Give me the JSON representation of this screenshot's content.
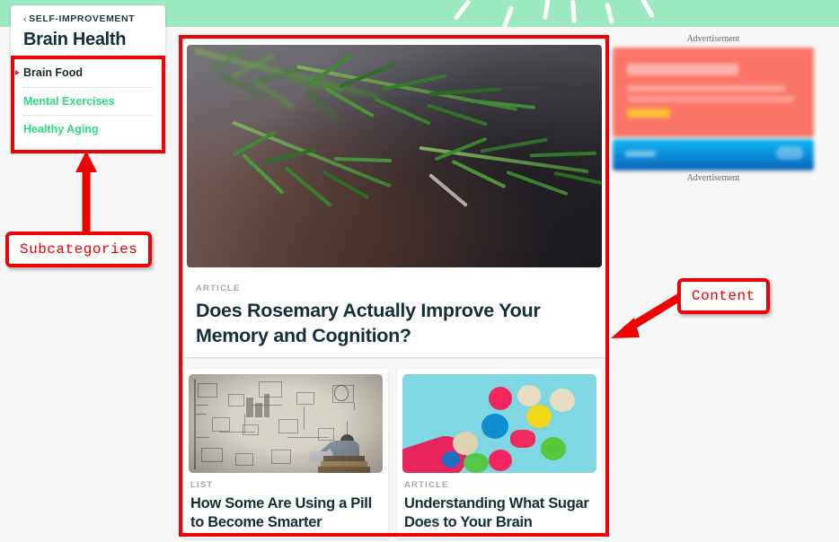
{
  "theme": {
    "band_green": "#9CE8C1",
    "link_green": "#2ddb7e",
    "heading_dark": "#123036",
    "annotation_red": "#f00000",
    "page_bg": "#f7f7f7"
  },
  "sidebar": {
    "breadcrumb_chevron": "chevron-left-icon",
    "breadcrumb": "SELF-IMPROVEMENT",
    "title": "Brain Health",
    "items": [
      {
        "label": "Brain Food",
        "active": true
      },
      {
        "label": "Mental Exercises",
        "active": false
      },
      {
        "label": "Healthy Aging",
        "active": false
      }
    ]
  },
  "main": {
    "featured": {
      "kicker": "ARTICLE",
      "headline": "Does Rosemary Actually Improve Your Memory and Cognition?",
      "image_alt": "rosemary-sprigs-photo"
    },
    "cards": [
      {
        "kicker": "LIST",
        "headline": "How Some Are Using a Pill to Become Smarter",
        "image_alt": "man-with-laptop-sketch-wall-photo"
      },
      {
        "kicker": "ARTICLE",
        "headline": "Understanding What Sugar Does to Your Brain",
        "image_alt": "colorful-macarons-photo"
      }
    ]
  },
  "ads": {
    "top_label": "Advertisement",
    "bottom_label": "Advertisement"
  },
  "annotations": [
    {
      "label": "Subcategories",
      "target": "sidebar-subcategory-list"
    },
    {
      "label": "Content",
      "target": "main-content-column"
    }
  ]
}
